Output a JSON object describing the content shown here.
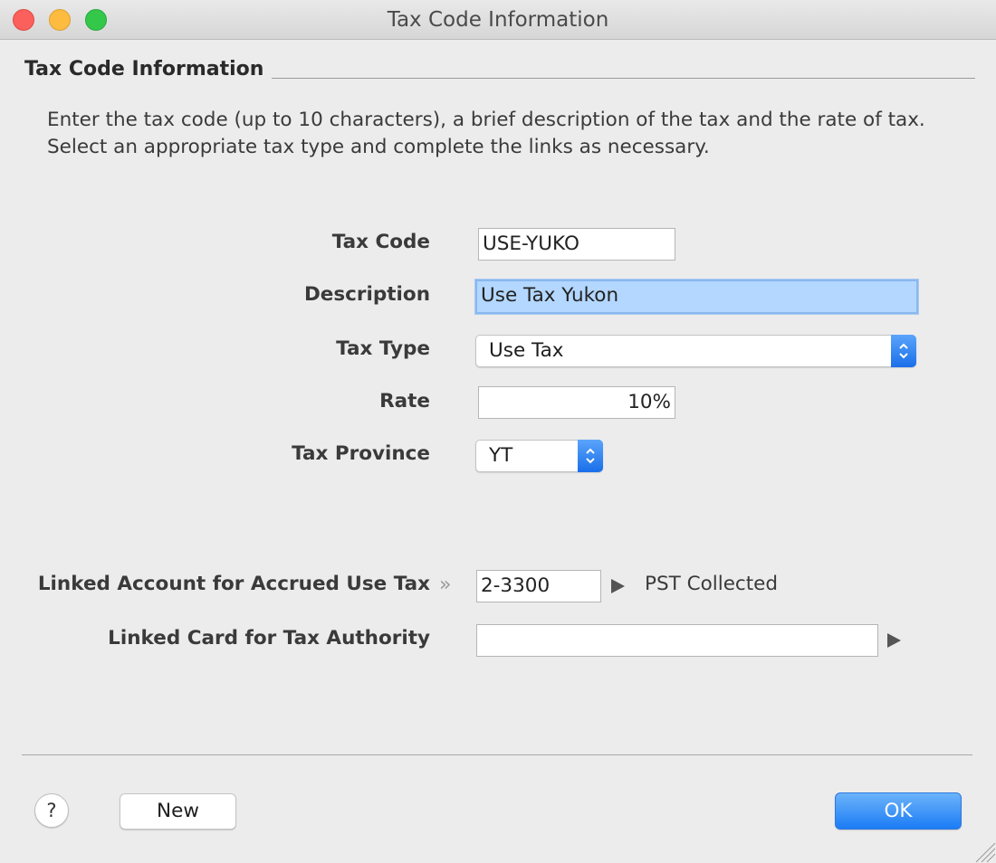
{
  "window": {
    "title": "Tax Code Information"
  },
  "group": {
    "title": "Tax Code Information",
    "instructions": "Enter the tax code (up to 10 characters), a brief description of the tax and the rate of tax.  Select an appropriate tax type and complete the links as necessary."
  },
  "form": {
    "tax_code": {
      "label": "Tax Code",
      "value": "USE-YUKO"
    },
    "description": {
      "label": "Description",
      "value": "Use Tax Yukon"
    },
    "tax_type": {
      "label": "Tax Type",
      "value": "Use Tax"
    },
    "rate": {
      "label": "Rate",
      "value": "10%"
    },
    "tax_province": {
      "label": "Tax Province",
      "value": "YT"
    },
    "linked_account": {
      "label": "Linked Account for Accrued Use Tax",
      "value": "2-3300",
      "account_name": "PST Collected"
    },
    "linked_card": {
      "label": "Linked Card for Tax Authority",
      "value": ""
    }
  },
  "buttons": {
    "help": "?",
    "new": "New",
    "ok": "OK"
  },
  "icons": {
    "linked_account_chevrons": "»",
    "lookup_arrow": "triangle-right",
    "popup_stepper": "chevron-up-down"
  },
  "colors": {
    "accent": "#1b7cf5",
    "focus_fill": "#b3d7ff",
    "traffic_close": "#fc605c",
    "traffic_minimize": "#fdbc40",
    "traffic_maximize": "#34c84a"
  }
}
